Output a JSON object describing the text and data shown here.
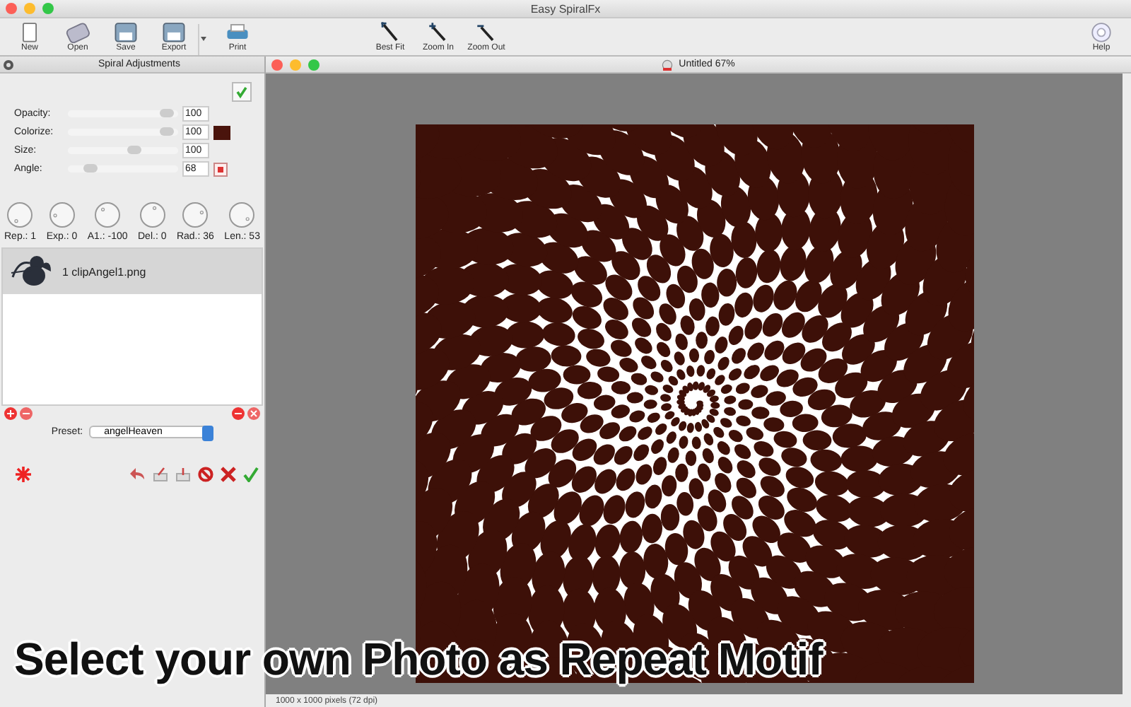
{
  "window": {
    "title": "Easy SpiralFx"
  },
  "toolbar": [
    {
      "label": "New",
      "kind": "new"
    },
    {
      "label": "Open",
      "kind": "open"
    },
    {
      "label": "Save",
      "kind": "save"
    },
    {
      "label": "Export",
      "kind": "export"
    },
    {
      "label": "Print",
      "kind": "print"
    },
    {
      "label": "Best Fit",
      "kind": "fit"
    },
    {
      "label": "Zoom In",
      "kind": "zoomin"
    },
    {
      "label": "Zoom Out",
      "kind": "zoomout"
    },
    {
      "label": "Help",
      "kind": "help"
    }
  ],
  "panel": {
    "title": "Spiral Adjustments",
    "sliders": [
      {
        "label": "Opacity:",
        "level": 0.9,
        "reading": "100",
        "kind": "plain"
      },
      {
        "label": "Colorize:",
        "level": 0.9,
        "reading": "100",
        "kind": "swatch",
        "color": "#4a140c"
      },
      {
        "label": "Size:",
        "level": 0.6,
        "reading": "100",
        "kind": "plain"
      },
      {
        "label": "Angle:",
        "level": 0.2,
        "reading": "68",
        "kind": "reset"
      }
    ],
    "knobs": [
      "Rep.: 1",
      "Exp.: 0",
      "A1.: -100",
      "Del.: 0",
      "Rad.: 36",
      "Len.: 53"
    ],
    "layers": [
      {
        "name": "1 clipAngel1.png",
        "selected": true
      }
    ],
    "preset": {
      "label": "Preset:",
      "value": "angelHeaven"
    }
  },
  "document": {
    "title": "Untitled 67%",
    "status": "1000 x 1000 pixels (72 dpi)"
  },
  "caption": "Select your own Photo as Repeat Motif"
}
